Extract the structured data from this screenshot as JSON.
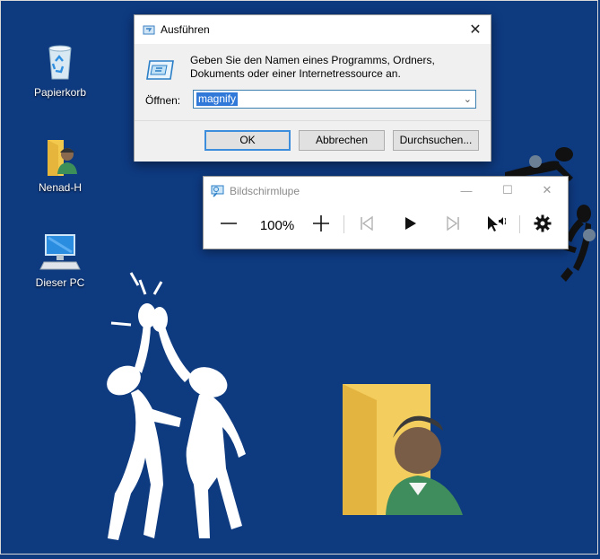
{
  "desktop": {
    "icons": [
      {
        "label": "Papierkorb",
        "icon": "recycle-bin-icon"
      },
      {
        "label": "Nenad-H",
        "icon": "user-folder-icon"
      },
      {
        "label": "Dieser PC",
        "icon": "computer-icon"
      }
    ]
  },
  "run_dialog": {
    "title": "Ausführen",
    "description": "Geben Sie den Namen eines Programms, Ordners, Dokuments oder einer Internetressource an.",
    "open_label": "Öffnen:",
    "input_value": "magnify",
    "buttons": {
      "ok": "OK",
      "cancel": "Abbrechen",
      "browse": "Durchsuchen..."
    }
  },
  "magnifier": {
    "title": "Bildschirmlupe",
    "zoom": "100%"
  },
  "colors": {
    "desktop": "#0e3a80",
    "selection": "#3179d8",
    "focus": "#3c8ddc"
  }
}
